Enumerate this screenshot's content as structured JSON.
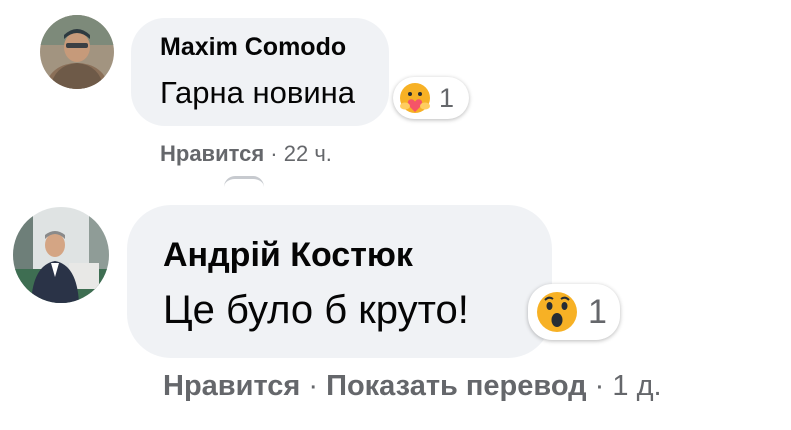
{
  "comments": [
    {
      "author": "Maxim Comodo",
      "text": "Гарна новина",
      "reaction": {
        "icon": "care-reaction-icon",
        "count": "1"
      },
      "actions": {
        "like": "Нравится",
        "separator": "·",
        "time": "22 ч."
      }
    },
    {
      "author": "Андрій Костюк",
      "text": "Це було б круто!",
      "reaction": {
        "icon": "wow-reaction-icon",
        "count": "1"
      },
      "actions": {
        "like": "Нравится",
        "separator": "·",
        "translate": "Показать перевод",
        "separator2": "·",
        "time": "1 д."
      }
    }
  ],
  "colors": {
    "bubble": "#f0f2f5",
    "secondary_text": "#65676b",
    "reaction_yellow": "#f7b125"
  }
}
